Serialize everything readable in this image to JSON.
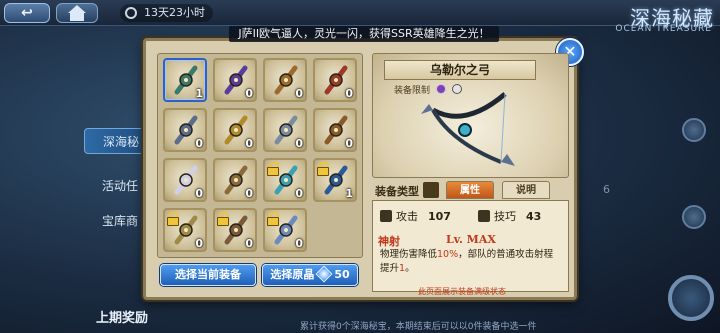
{
  "topbar": {
    "timer_text": "13天23小时",
    "event_title": "深海秘藏",
    "event_subtitle": "OCEAN TREASURE"
  },
  "left_nav": {
    "items": [
      {
        "label": "深海秘",
        "active": true
      },
      {
        "label": "活动任",
        "active": false
      },
      {
        "label": "宝库商",
        "active": false
      }
    ]
  },
  "bottom": {
    "reward_label": "上期奖励",
    "note": "累计获得0个深海秘宝，本期结束后可以以0件装备中选一件",
    "faded_number": "6"
  },
  "dialog": {
    "banner_text": "J萨II欧气逼人，灵光一闪，获得SSR英雄降生之光！",
    "close_icon": "close-icon",
    "items": [
      {
        "name": "bow",
        "count": "1",
        "locked": false,
        "selected": true,
        "color": "#3b7a6a"
      },
      {
        "name": "armor-purple",
        "count": "0",
        "locked": false,
        "selected": false,
        "color": "#5a3d9a"
      },
      {
        "name": "helmet-gold",
        "count": "0",
        "locked": false,
        "selected": false,
        "color": "#9c6a2c"
      },
      {
        "name": "staff-red",
        "count": "0",
        "locked": false,
        "selected": false,
        "color": "#9c3a2a"
      },
      {
        "name": "gauntlet",
        "count": "0",
        "locked": false,
        "selected": false,
        "color": "#5c6d8c"
      },
      {
        "name": "scepter-gold",
        "count": "0",
        "locked": false,
        "selected": false,
        "color": "#b18a2a"
      },
      {
        "name": "sword-curved",
        "count": "0",
        "locked": false,
        "selected": false,
        "color": "#7c8ca0"
      },
      {
        "name": "shield-round",
        "count": "0",
        "locked": false,
        "selected": false,
        "color": "#8a5a2a"
      },
      {
        "name": "robe-white",
        "count": "0",
        "locked": false,
        "selected": false,
        "color": "#d0d0e8"
      },
      {
        "name": "axe",
        "count": "0",
        "locked": false,
        "selected": false,
        "color": "#8a6a3a"
      },
      {
        "name": "blade-cyan",
        "count": "0",
        "locked": true,
        "selected": false,
        "color": "#3aa0b8"
      },
      {
        "name": "staff-blue",
        "count": "1",
        "locked": true,
        "selected": false,
        "color": "#2a5a9a"
      },
      {
        "name": "chakram",
        "count": "0",
        "locked": true,
        "selected": false,
        "color": "#a08a4a"
      },
      {
        "name": "hammer",
        "count": "0",
        "locked": true,
        "selected": false,
        "color": "#7a5a3a"
      },
      {
        "name": "armor-blue",
        "count": "0",
        "locked": true,
        "selected": false,
        "color": "#6a8ac0"
      }
    ],
    "btn_select_equip": "选择当前装备",
    "btn_select_origin": "选择原晶",
    "btn_select_origin_cost": "50",
    "detail": {
      "item_name": "乌勒尔之弓",
      "restrict_label": "装备限制",
      "equip_type_label": "装备类型",
      "tab_attr": "属性",
      "tab_desc": "说明",
      "stat_attack_label": "攻击",
      "stat_attack_value": "107",
      "stat_skill_label": "技巧",
      "stat_skill_value": "43",
      "skill_name": "神射",
      "skill_level": "Lv. MAX",
      "skill_desc_1": "物理伤害降低",
      "skill_desc_hl": "10%",
      "skill_desc_2": "，部队的普通攻击射程提升",
      "skill_desc_num": "1",
      "skill_desc_end": "。",
      "footer_note": "此页面展示装备满级状态"
    }
  },
  "colors": {
    "accent_blue": "#1f5fb8",
    "tab_active": "#c0561a",
    "highlight_red": "#c2391c",
    "panel_bg": "#d9cdb0"
  }
}
